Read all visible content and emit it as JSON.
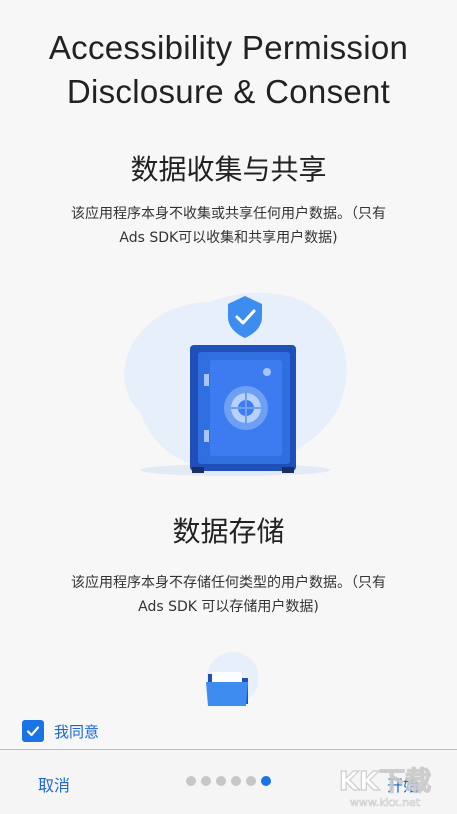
{
  "header": {
    "title_line1": "Accessibility Permission",
    "title_line2": "Disclosure & Consent"
  },
  "sections": [
    {
      "title": "数据收集与共享",
      "desc_line1": "该应用程序本身不收集或共享任何用户数据。（只有",
      "desc_line2": "Ads SDK可以收集和共享用户数据)",
      "icon": "safe-with-shield-icon"
    },
    {
      "title": "数据存储",
      "desc_line1": "该应用程序本身不存储任何类型的用户数据。（只有",
      "desc_line2": "Ads SDK 可以存储用户数据)",
      "icon": "folder-icon"
    }
  ],
  "consent": {
    "checked": true,
    "label": "我同意"
  },
  "footer": {
    "cancel_label": "取消",
    "start_label": "开始",
    "page_count": 6,
    "current_page": 6
  },
  "watermark": {
    "text": "KK下载",
    "url": "www.kkx.net"
  },
  "colors": {
    "accent": "#1b73e8",
    "safe_blue": "#2f6fe0",
    "shield_blue": "#3d8cf0",
    "blob": "#e6effa"
  }
}
